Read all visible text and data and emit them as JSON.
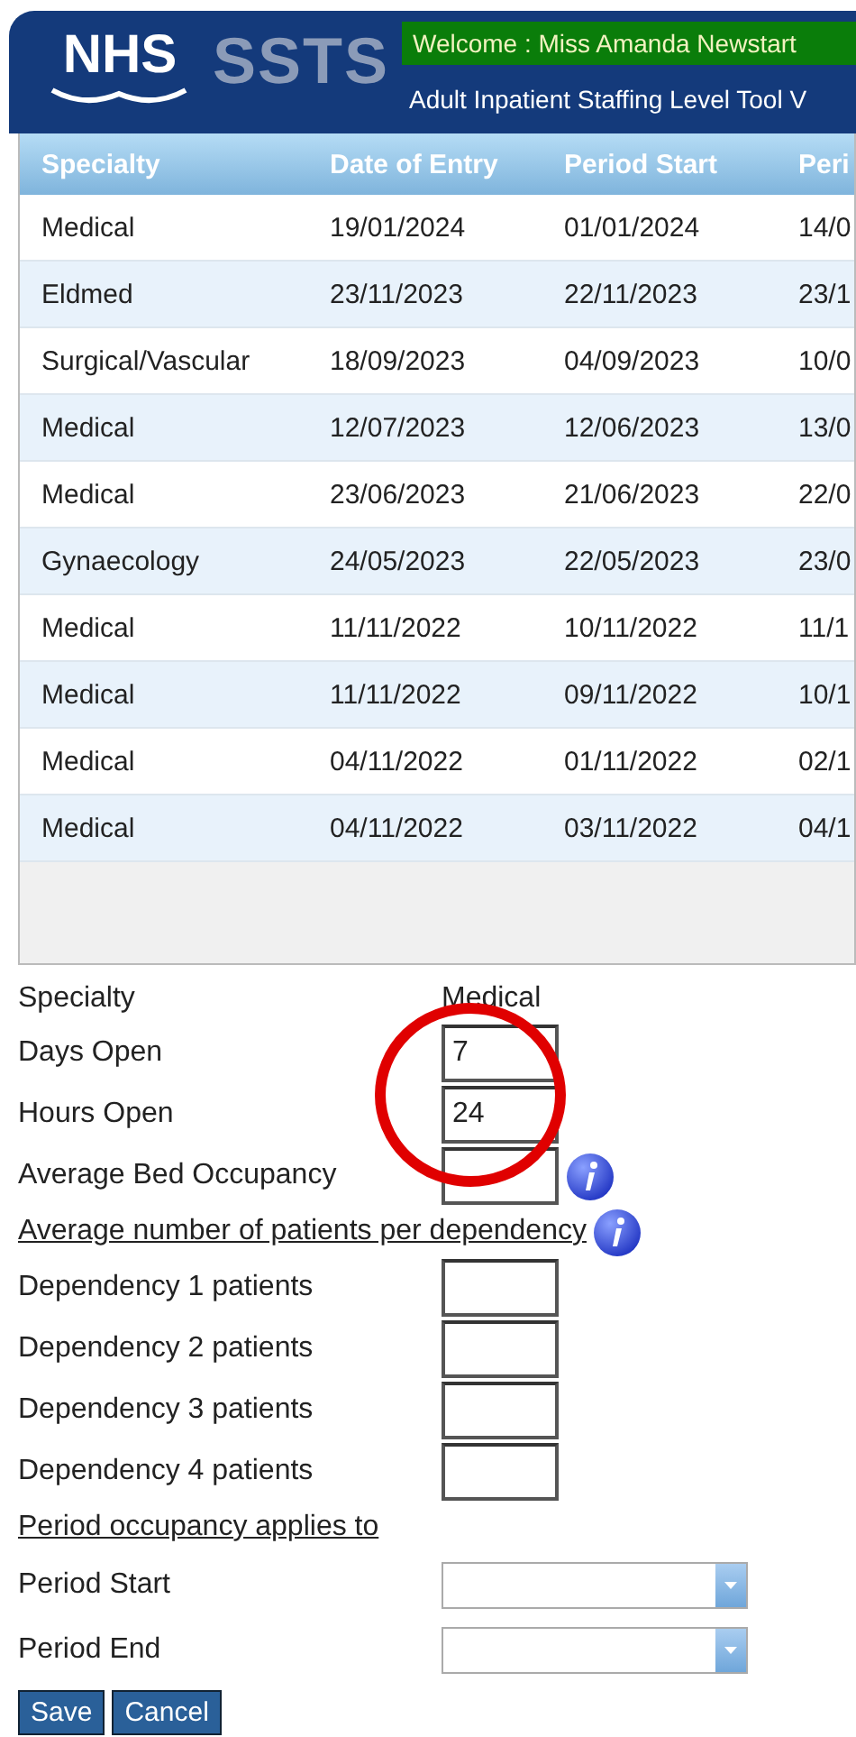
{
  "header": {
    "logo": "NHS",
    "app_name": "SSTS",
    "welcome": "Welcome : Miss Amanda Newstart",
    "subtitle": "Adult Inpatient Staffing Level Tool V"
  },
  "table": {
    "columns": [
      "Specialty",
      "Date of Entry",
      "Period Start",
      "Peri"
    ],
    "rows": [
      {
        "cells": [
          "Medical",
          "19/01/2024",
          "01/01/2024",
          "14/0"
        ]
      },
      {
        "cells": [
          "Eldmed",
          "23/11/2023",
          "22/11/2023",
          "23/1"
        ]
      },
      {
        "cells": [
          "Surgical/Vascular",
          "18/09/2023",
          "04/09/2023",
          "10/0"
        ]
      },
      {
        "cells": [
          "Medical",
          "12/07/2023",
          "12/06/2023",
          "13/0"
        ]
      },
      {
        "cells": [
          "Medical",
          "23/06/2023",
          "21/06/2023",
          "22/0"
        ]
      },
      {
        "cells": [
          "Gynaecology",
          "24/05/2023",
          "22/05/2023",
          "23/0"
        ]
      },
      {
        "cells": [
          "Medical",
          "11/11/2022",
          "10/11/2022",
          "11/1"
        ]
      },
      {
        "cells": [
          "Medical",
          "11/11/2022",
          "09/11/2022",
          "10/1"
        ]
      },
      {
        "cells": [
          "Medical",
          "04/11/2022",
          "01/11/2022",
          "02/1"
        ]
      },
      {
        "cells": [
          "Medical",
          "04/11/2022",
          "03/11/2022",
          "04/1"
        ]
      }
    ]
  },
  "form": [
    {
      "kind": "text",
      "label": "Specialty",
      "value": "Medical"
    },
    {
      "kind": "input",
      "label": "Days Open",
      "value": "7"
    },
    {
      "kind": "input",
      "label": "Hours Open",
      "value": "24"
    },
    {
      "kind": "input_info",
      "label": "Average Bed Occupancy"
    },
    {
      "kind": "heading_info",
      "label": "Average number of patients per dependency"
    },
    {
      "kind": "input",
      "label": "Dependency 1 patients"
    },
    {
      "kind": "input",
      "label": "Dependency 2 patients"
    },
    {
      "kind": "input",
      "label": "Dependency 3 patients"
    },
    {
      "kind": "input",
      "label": "Dependency 4 patients"
    },
    {
      "kind": "heading",
      "label": "Period occupancy applies to"
    },
    {
      "kind": "select",
      "label": "Period Start"
    },
    {
      "kind": "select",
      "label": "Period End"
    }
  ],
  "buttons": [
    "Save",
    "Cancel"
  ]
}
